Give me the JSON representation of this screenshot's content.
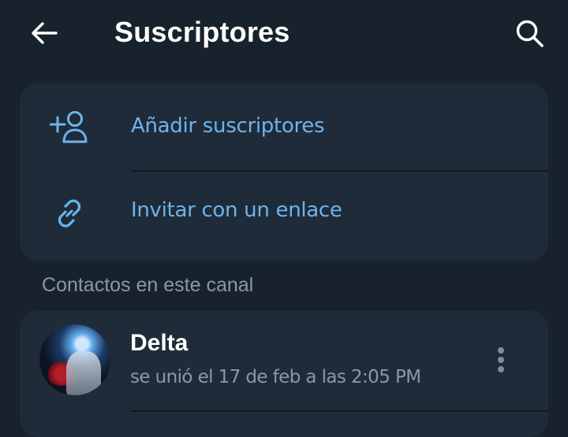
{
  "header": {
    "title": "Suscriptores",
    "back_icon": "arrow-left-icon",
    "search_icon": "search-icon"
  },
  "actions": [
    {
      "label": "Añadir suscriptores",
      "icon": "add-user-icon"
    },
    {
      "label": "Invitar con un enlace",
      "icon": "link-icon"
    }
  ],
  "section": {
    "title": "Contactos en este canal"
  },
  "members": [
    {
      "name": "Delta",
      "status": "se unió el 17 de feb a las 2:05 PM",
      "avatar": "avatar-image",
      "menu_icon": "more-vertical-icon"
    }
  ],
  "colors": {
    "background": "#18222d",
    "card": "#1f2b38",
    "accent": "#6cb4ec",
    "muted": "#8a98a6"
  }
}
